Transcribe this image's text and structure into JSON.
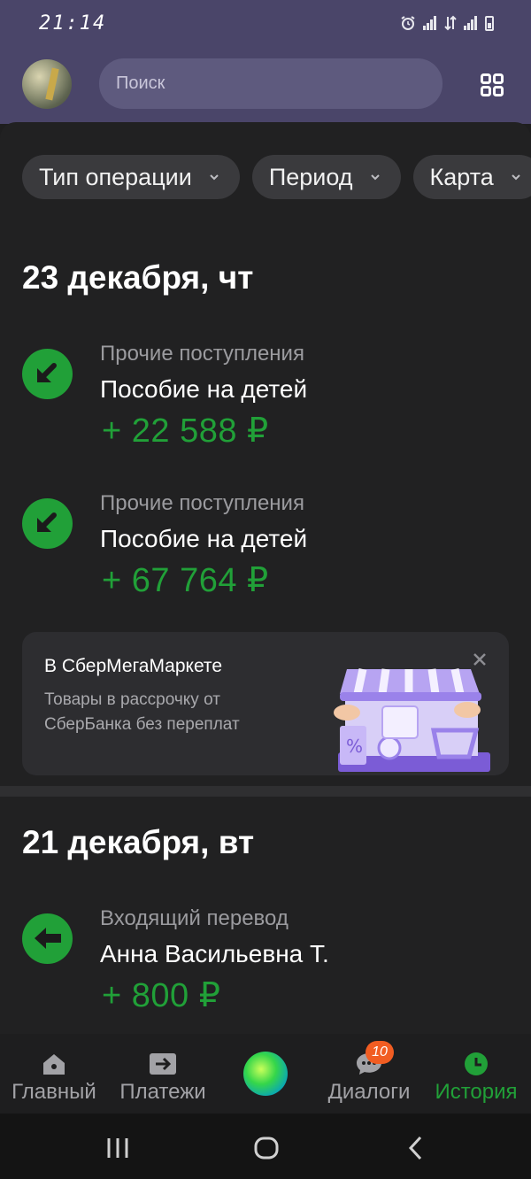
{
  "status_bar": {
    "time": "21:14"
  },
  "header": {
    "search_placeholder": "Поиск"
  },
  "filters": [
    {
      "label": "Тип операции"
    },
    {
      "label": "Период"
    },
    {
      "label": "Карта"
    }
  ],
  "sections": [
    {
      "date": "23 декабря, чт",
      "operations": [
        {
          "category": "Прочие поступления",
          "name": "Пособие на детей",
          "amount": "+ 22 588 ₽",
          "icon": "incoming-arrow-icon"
        },
        {
          "category": "Прочие поступления",
          "name": "Пособие на детей",
          "amount": "+ 67 764 ₽",
          "icon": "incoming-arrow-icon"
        }
      ]
    },
    {
      "date": "21 декабря, вт",
      "operations": [
        {
          "category": "Входящий перевод",
          "name": "Анна Васильевна Т.",
          "amount": "+ 800 ₽",
          "icon": "transfer-arrow-icon"
        }
      ]
    }
  ],
  "promo": {
    "title": "В СберМегаМаркете",
    "text": "Товары в рассрочку от СберБанка без переплат"
  },
  "bottom_nav": {
    "items": [
      {
        "label": "Главный",
        "icon": "home-icon"
      },
      {
        "label": "Платежи",
        "icon": "payments-icon"
      },
      {
        "label": "",
        "icon": "salut-assistant-icon"
      },
      {
        "label": "Диалоги",
        "icon": "chat-icon",
        "badge": "10"
      },
      {
        "label": "История",
        "icon": "clock-icon",
        "active": true
      }
    ]
  },
  "colors": {
    "accent": "#21a038",
    "header_bg": "#4a4569",
    "badge": "#f15d22"
  }
}
